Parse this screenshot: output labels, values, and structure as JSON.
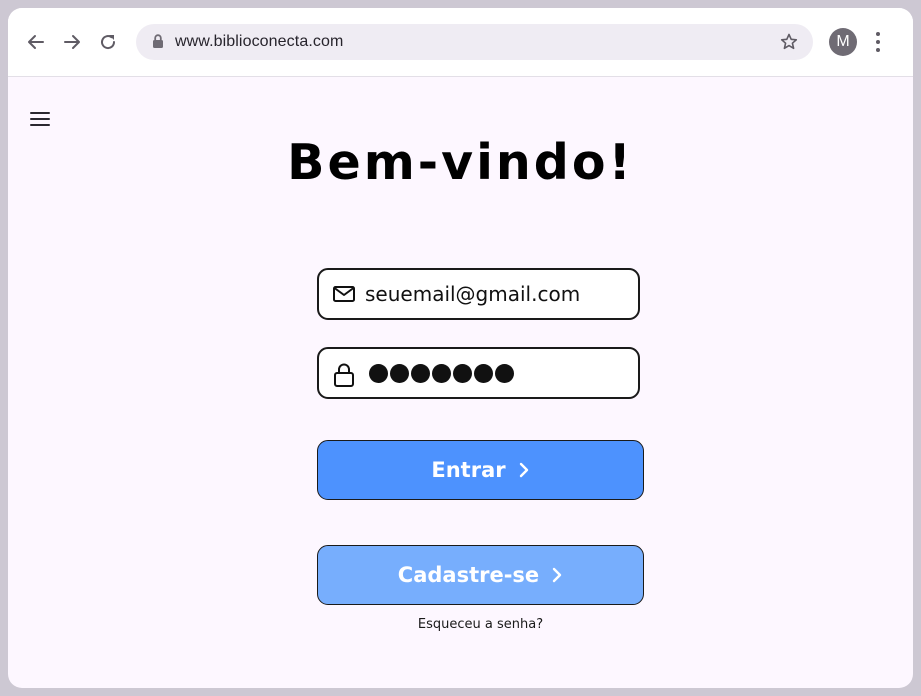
{
  "browser": {
    "url": "www.biblioconecta.com",
    "profile_initial": "M"
  },
  "page": {
    "title": "Bem-vindo!",
    "email_value": "seuemail@gmail.com",
    "password_mask": "●●●●●●●",
    "login_label": "Entrar",
    "signup_label": "Cadastre-se",
    "forgot_label": "Esqueceu a senha?"
  },
  "colors": {
    "primary_button": "#4d92fe",
    "secondary_button": "#77aefd",
    "page_background": "#fdf7ff"
  }
}
